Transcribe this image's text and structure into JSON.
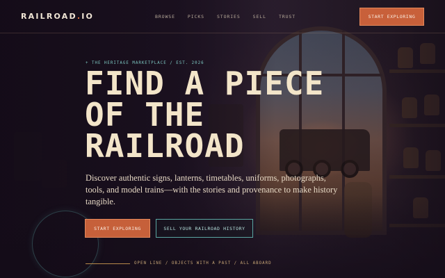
{
  "brand": {
    "name": "RAILROAD",
    "dot": ".",
    "suffix": "IO",
    "accent_color": "#e0703f"
  },
  "nav": {
    "items": [
      {
        "label": "BROWSE"
      },
      {
        "label": "PICKS"
      },
      {
        "label": "STORIES"
      },
      {
        "label": "SELL"
      },
      {
        "label": "TRUST"
      }
    ],
    "cta_label": "START EXPLORING"
  },
  "hero": {
    "eyebrow": "+ THE HERITAGE MARKETPLACE / EST. 2026",
    "headline_lines": [
      "FIND A PIECE",
      "OF THE",
      "RAILROAD"
    ],
    "lede": "Discover authentic signs, lanterns, timetables, uniforms, photographs, tools, and model trains—with the stories and provenance to make history tangible.",
    "primary_cta": "START EXPLORING",
    "secondary_cta": "SELL YOUR RAILROAD HISTORY",
    "tagline": "OPEN LINE / OBJECTS WITH A PAST / ALL ABOARD"
  },
  "colors": {
    "accent": "#c6603a",
    "teal": "#5aa6a2",
    "headline": "#f3e5c9",
    "background": "#1c1220"
  }
}
